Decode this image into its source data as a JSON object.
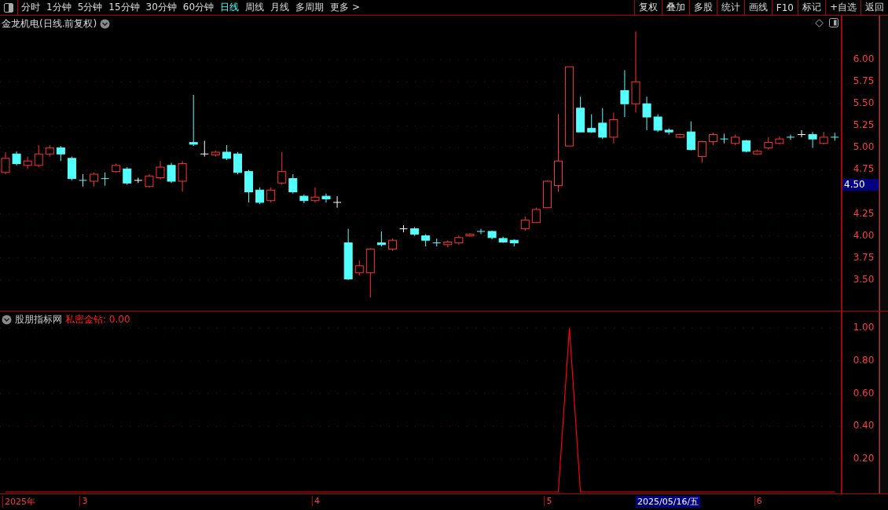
{
  "toolbar": {
    "periods": [
      {
        "label": "分时",
        "selected": false
      },
      {
        "label": "1分钟",
        "selected": false
      },
      {
        "label": "5分钟",
        "selected": false
      },
      {
        "label": "15分钟",
        "selected": false
      },
      {
        "label": "30分钟",
        "selected": false
      },
      {
        "label": "60分钟",
        "selected": false
      },
      {
        "label": "日线",
        "selected": true
      },
      {
        "label": "周线",
        "selected": false
      },
      {
        "label": "月线",
        "selected": false
      },
      {
        "label": "多周期",
        "selected": false
      },
      {
        "label": "更多 >",
        "selected": false
      }
    ],
    "buttons": [
      "复权",
      "叠加",
      "多股",
      "统计",
      "画线",
      "F10",
      "标记",
      "+自选",
      "返回"
    ]
  },
  "main_chart": {
    "title": "金龙机电(日线.前复权)",
    "current_price": "4.50",
    "chart_data": {
      "type": "candlestick",
      "grid": true,
      "ylim": [
        3.15,
        6.5
      ],
      "yticks": [
        {
          "value": 6,
          "label": "6.00"
        },
        {
          "value": 5.75,
          "label": "5.75"
        },
        {
          "value": 5.5,
          "label": "5.50"
        },
        {
          "value": 5.25,
          "label": "5.25"
        },
        {
          "value": 5,
          "label": "5.00"
        },
        {
          "value": 4.75,
          "label": "4.75"
        },
        {
          "value": 4.25,
          "label": "4.25"
        },
        {
          "value": 4,
          "label": "4.00"
        },
        {
          "value": 3.75,
          "label": "3.75"
        },
        {
          "value": 3.5,
          "label": "3.50"
        }
      ],
      "ohlc": [
        [
          4.72,
          4.95,
          4.7,
          4.88
        ],
        [
          4.93,
          4.96,
          4.8,
          4.82
        ],
        [
          4.8,
          4.9,
          4.76,
          4.85
        ],
        [
          4.8,
          5.03,
          4.78,
          4.93
        ],
        [
          4.93,
          5.03,
          4.9,
          5.0
        ],
        [
          5.0,
          5.02,
          4.85,
          4.93
        ],
        [
          4.88,
          4.9,
          4.63,
          4.65
        ],
        [
          4.63,
          4.7,
          4.56,
          4.63
        ],
        [
          4.62,
          4.72,
          4.56,
          4.7
        ],
        [
          4.65,
          4.72,
          4.57,
          4.65
        ],
        [
          4.73,
          4.82,
          4.72,
          4.8
        ],
        [
          4.76,
          4.78,
          4.58,
          4.6
        ],
        [
          4.63,
          4.66,
          4.6,
          4.63
        ],
        [
          4.56,
          4.7,
          4.55,
          4.68
        ],
        [
          4.66,
          4.85,
          4.64,
          4.78
        ],
        [
          4.8,
          4.83,
          4.6,
          4.62
        ],
        [
          4.62,
          4.85,
          4.5,
          4.82
        ],
        [
          5.06,
          5.6,
          5.02,
          5.04
        ],
        [
          4.93,
          5.08,
          4.9,
          4.93
        ],
        [
          4.92,
          4.97,
          4.9,
          4.95
        ],
        [
          4.95,
          5.03,
          4.86,
          4.88
        ],
        [
          4.93,
          4.95,
          4.7,
          4.72
        ],
        [
          4.73,
          4.75,
          4.38,
          4.5
        ],
        [
          4.52,
          4.55,
          4.36,
          4.38
        ],
        [
          4.4,
          4.55,
          4.38,
          4.52
        ],
        [
          4.6,
          4.95,
          4.58,
          4.73
        ],
        [
          4.65,
          4.7,
          4.48,
          4.5
        ],
        [
          4.45,
          4.47,
          4.37,
          4.4
        ],
        [
          4.4,
          4.55,
          4.38,
          4.44
        ],
        [
          4.45,
          4.48,
          4.38,
          4.42
        ],
        [
          4.38,
          4.45,
          4.32,
          4.38
        ],
        [
          3.92,
          4.08,
          3.5,
          3.51
        ],
        [
          3.58,
          3.72,
          3.55,
          3.66
        ],
        [
          3.58,
          3.86,
          3.3,
          3.85
        ],
        [
          3.92,
          4.05,
          3.88,
          3.9
        ],
        [
          3.85,
          3.97,
          3.83,
          3.95
        ],
        [
          4.08,
          4.12,
          4.04,
          4.08
        ],
        [
          4.08,
          4.1,
          4.0,
          4.02
        ],
        [
          4.0,
          4.02,
          3.88,
          3.95
        ],
        [
          3.92,
          3.97,
          3.88,
          3.92
        ],
        [
          3.9,
          3.95,
          3.87,
          3.93
        ],
        [
          3.92,
          4.0,
          3.9,
          3.98
        ],
        [
          4.0,
          4.03,
          3.99,
          4.02
        ],
        [
          4.05,
          4.08,
          4.02,
          4.05
        ],
        [
          4.05,
          4.06,
          3.96,
          3.98
        ],
        [
          3.97,
          3.99,
          3.92,
          3.93
        ],
        [
          3.95,
          3.96,
          3.88,
          3.92
        ],
        [
          4.08,
          4.22,
          4.06,
          4.18
        ],
        [
          4.15,
          4.32,
          4.15,
          4.3
        ],
        [
          4.32,
          4.63,
          4.32,
          4.62
        ],
        [
          4.57,
          5.38,
          4.5,
          4.85
        ],
        [
          5.02,
          5.92,
          5.02,
          5.92
        ],
        [
          5.45,
          5.58,
          5.18,
          5.18
        ],
        [
          5.22,
          5.38,
          5.17,
          5.18
        ],
        [
          5.28,
          5.45,
          5.1,
          5.12
        ],
        [
          5.12,
          5.4,
          5.05,
          5.32
        ],
        [
          5.65,
          5.88,
          5.35,
          5.5
        ],
        [
          5.5,
          6.32,
          5.4,
          5.75
        ],
        [
          5.5,
          5.58,
          5.2,
          5.35
        ],
        [
          5.35,
          5.38,
          5.18,
          5.2
        ],
        [
          5.2,
          5.22,
          5.15,
          5.18
        ],
        [
          5.12,
          5.16,
          5.11,
          5.15
        ],
        [
          5.18,
          5.3,
          4.97,
          4.98
        ],
        [
          4.9,
          5.08,
          4.83,
          5.07
        ],
        [
          5.07,
          5.17,
          5.03,
          5.15
        ],
        [
          5.1,
          5.16,
          5.05,
          5.1
        ],
        [
          5.05,
          5.15,
          5.03,
          5.12
        ],
        [
          5.08,
          5.09,
          4.95,
          4.96
        ],
        [
          4.93,
          4.98,
          4.92,
          4.96
        ],
        [
          5.0,
          5.12,
          4.98,
          5.06
        ],
        [
          5.05,
          5.13,
          5.04,
          5.1
        ],
        [
          5.12,
          5.15,
          5.09,
          5.12
        ],
        [
          5.15,
          5.2,
          5.12,
          5.15
        ],
        [
          5.15,
          5.18,
          5.0,
          5.1
        ],
        [
          5.05,
          5.18,
          5.04,
          5.12
        ],
        [
          5.12,
          5.17,
          5.08,
          5.12
        ]
      ]
    }
  },
  "indicator": {
    "source": "股朋指标网",
    "reading": "私密金钻: 0.00",
    "chart_data": {
      "type": "line",
      "grid": true,
      "ylim": [
        0,
        1.1
      ],
      "yticks": [
        {
          "value": 0.2,
          "label": "0.20"
        },
        {
          "value": 0.4,
          "label": "0.40"
        },
        {
          "value": 0.6,
          "label": "0.60"
        },
        {
          "value": 0.8,
          "label": "0.80"
        },
        {
          "value": 1,
          "label": "1.00"
        }
      ],
      "series": [
        {
          "color": "#ff0000",
          "values": [
            0,
            0,
            0,
            0,
            0,
            0,
            0,
            0,
            0,
            0,
            0,
            0,
            0,
            0,
            0,
            0,
            0,
            0,
            0,
            0,
            0,
            0,
            0,
            0,
            0,
            0,
            0,
            0,
            0,
            0,
            0,
            0,
            0,
            0,
            0,
            0,
            0,
            0,
            0,
            0,
            0,
            0,
            0,
            0,
            0,
            0,
            0,
            0,
            0,
            0,
            0,
            1,
            0,
            0,
            0,
            0,
            0,
            0,
            0,
            0,
            0,
            0,
            0,
            0,
            0,
            0,
            0,
            0,
            0,
            0,
            0,
            0,
            0,
            0,
            0,
            0
          ]
        }
      ]
    }
  },
  "date_axis": [
    "2025年",
    "3",
    "4",
    "5",
    "6"
  ],
  "cursor_date": "2025/05/16/五"
}
